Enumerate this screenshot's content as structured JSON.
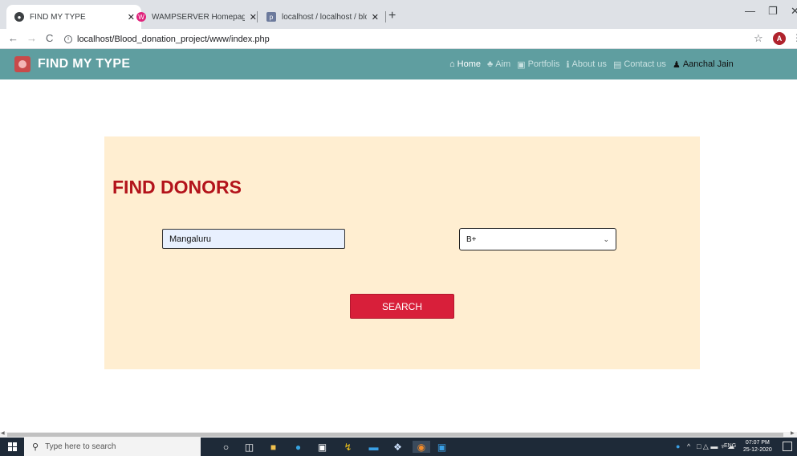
{
  "browser": {
    "tabs": [
      {
        "title": "FIND MY TYPE",
        "favicon": "globe-icon",
        "active": true
      },
      {
        "title": "WAMPSERVER Homepage",
        "favicon": "wampserver-icon",
        "active": false
      },
      {
        "title": "localhost / localhost / blood_ma",
        "favicon": "phpmyadmin-icon",
        "active": false
      }
    ],
    "new_tab": "+",
    "address": "localhost/Blood_donation_project/www/index.php",
    "profile_initial": "A"
  },
  "navbar": {
    "brand": "FIND MY TYPE",
    "links": [
      {
        "label": "Home",
        "icon": "home-icon",
        "active": true
      },
      {
        "label": "Aim",
        "icon": "trophy-icon"
      },
      {
        "label": "Portfolis",
        "icon": "image-icon"
      },
      {
        "label": "About us",
        "icon": "info-icon"
      },
      {
        "label": "Contact us",
        "icon": "id-card-icon"
      },
      {
        "label": "Aanchal Jain",
        "icon": "user-icon"
      }
    ],
    "colors": {
      "bar": "#5f9ea0",
      "brand_text": "#ffffff"
    }
  },
  "search": {
    "heading": "FIND DONORS",
    "city_value": "Mangaluru",
    "blood_group": "B+",
    "button_label": "SEARCH",
    "colors": {
      "card_bg": "#ffeed1",
      "heading": "#b3131b",
      "button": "#d81f3a"
    }
  },
  "taskbar": {
    "search_placeholder": "Type here to search",
    "language": "ENG",
    "time": "07:07 PM",
    "date": "25-12-2020"
  }
}
